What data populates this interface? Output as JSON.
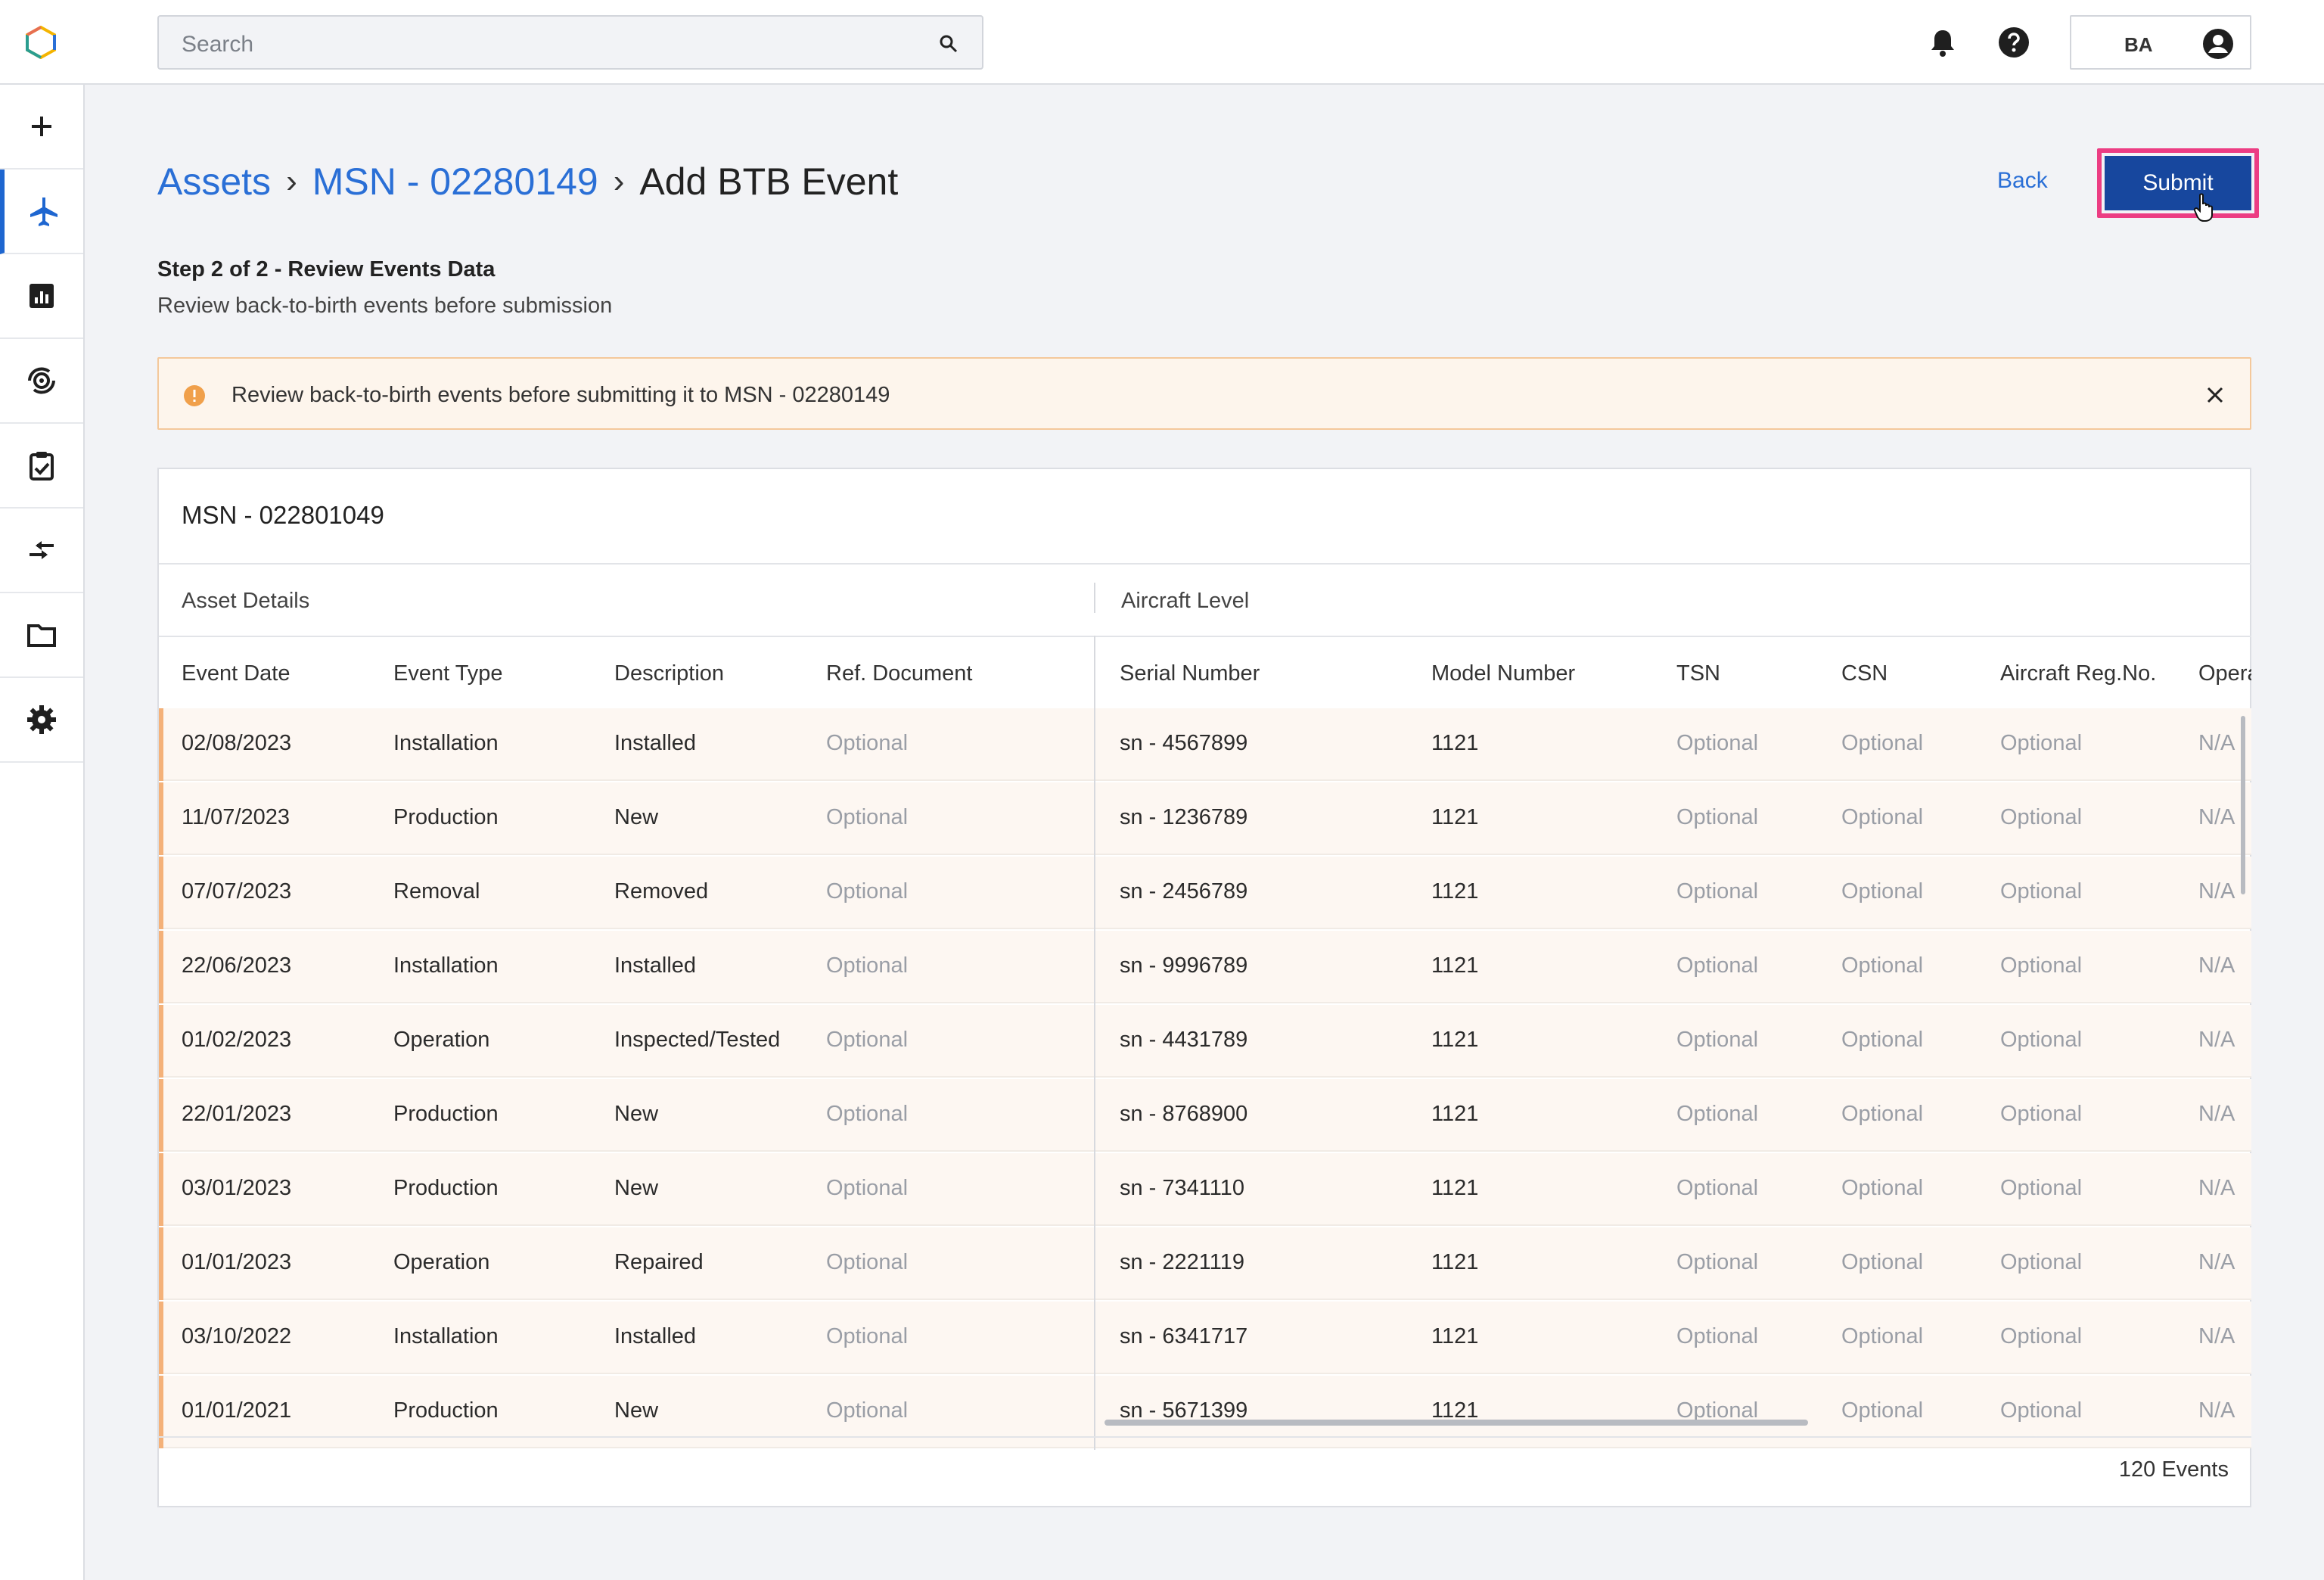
{
  "search": {
    "placeholder": "Search"
  },
  "user": {
    "initials": "BA"
  },
  "sidebar": {
    "items": [
      {
        "icon": "plus-icon",
        "active": false
      },
      {
        "icon": "airplane-icon",
        "active": true
      },
      {
        "icon": "chart-icon",
        "active": false
      },
      {
        "icon": "engine-rotate-icon",
        "active": false
      },
      {
        "icon": "clipboard-check-icon",
        "active": false
      },
      {
        "icon": "transfer-arrows-icon",
        "active": false
      },
      {
        "icon": "folder-icon",
        "active": false
      },
      {
        "icon": "gear-icon",
        "active": false
      }
    ]
  },
  "breadcrumb": {
    "assets": "Assets",
    "sep": "›",
    "msn": "MSN - 02280149",
    "current": "Add BTB Event"
  },
  "actions": {
    "back": "Back",
    "submit": "Submit"
  },
  "step": {
    "title": "Step 2 of 2 - Review Events Data",
    "subtitle": "Review back-to-birth events before submission"
  },
  "alert": {
    "text": "Review back-to-birth events before submitting it to MSN - 02280149",
    "color": "#f0a04b"
  },
  "table": {
    "title": "MSN - 022801049",
    "groups": {
      "asset_details": "Asset Details",
      "aircraft_level": "Aircraft Level"
    },
    "columns": [
      "Event Date",
      "Event Type",
      "Description",
      "Ref. Document",
      "Serial Number",
      "Model Number",
      "TSN",
      "CSN",
      "Aircraft Reg.No.",
      "Opera"
    ],
    "rows": [
      [
        "02/08/2023",
        "Installation",
        "Installed",
        "Optional",
        "sn - 4567899",
        "1121",
        "Optional",
        "Optional",
        "Optional",
        "N/A"
      ],
      [
        "11/07/2023",
        "Production",
        "New",
        "Optional",
        "sn - 1236789",
        "1121",
        "Optional",
        "Optional",
        "Optional",
        "N/A"
      ],
      [
        "07/07/2023",
        "Removal",
        "Removed",
        "Optional",
        "sn - 2456789",
        "1121",
        "Optional",
        "Optional",
        "Optional",
        "N/A"
      ],
      [
        "22/06/2023",
        "Installation",
        "Installed",
        "Optional",
        "sn - 9996789",
        "1121",
        "Optional",
        "Optional",
        "Optional",
        "N/A"
      ],
      [
        "01/02/2023",
        "Operation",
        "Inspected/Tested",
        "Optional",
        "sn - 4431789",
        "1121",
        "Optional",
        "Optional",
        "Optional",
        "N/A"
      ],
      [
        "22/01/2023",
        "Production",
        "New",
        "Optional",
        "sn - 8768900",
        "1121",
        "Optional",
        "Optional",
        "Optional",
        "N/A"
      ],
      [
        "03/01/2023",
        "Production",
        "New",
        "Optional",
        "sn - 7341110",
        "1121",
        "Optional",
        "Optional",
        "Optional",
        "N/A"
      ],
      [
        "01/01/2023",
        "Operation",
        "Repaired",
        "Optional",
        "sn - 2221119",
        "1121",
        "Optional",
        "Optional",
        "Optional",
        "N/A"
      ],
      [
        "03/10/2022",
        "Installation",
        "Installed",
        "Optional",
        "sn - 6341717",
        "1121",
        "Optional",
        "Optional",
        "Optional",
        "N/A"
      ],
      [
        "01/01/2021",
        "Production",
        "New",
        "Optional",
        "sn - 5671399",
        "1121",
        "Optional",
        "Optional",
        "Optional",
        "N/A"
      ]
    ],
    "muted_values": [
      "Optional",
      "N/A"
    ],
    "footer": "120 Events"
  },
  "colors": {
    "accent": "#2a6fd6",
    "submit": "#17479e",
    "highlight": "#ec3d83",
    "row_bg": "#fdf7f2",
    "row_accent": "#f4b179"
  }
}
